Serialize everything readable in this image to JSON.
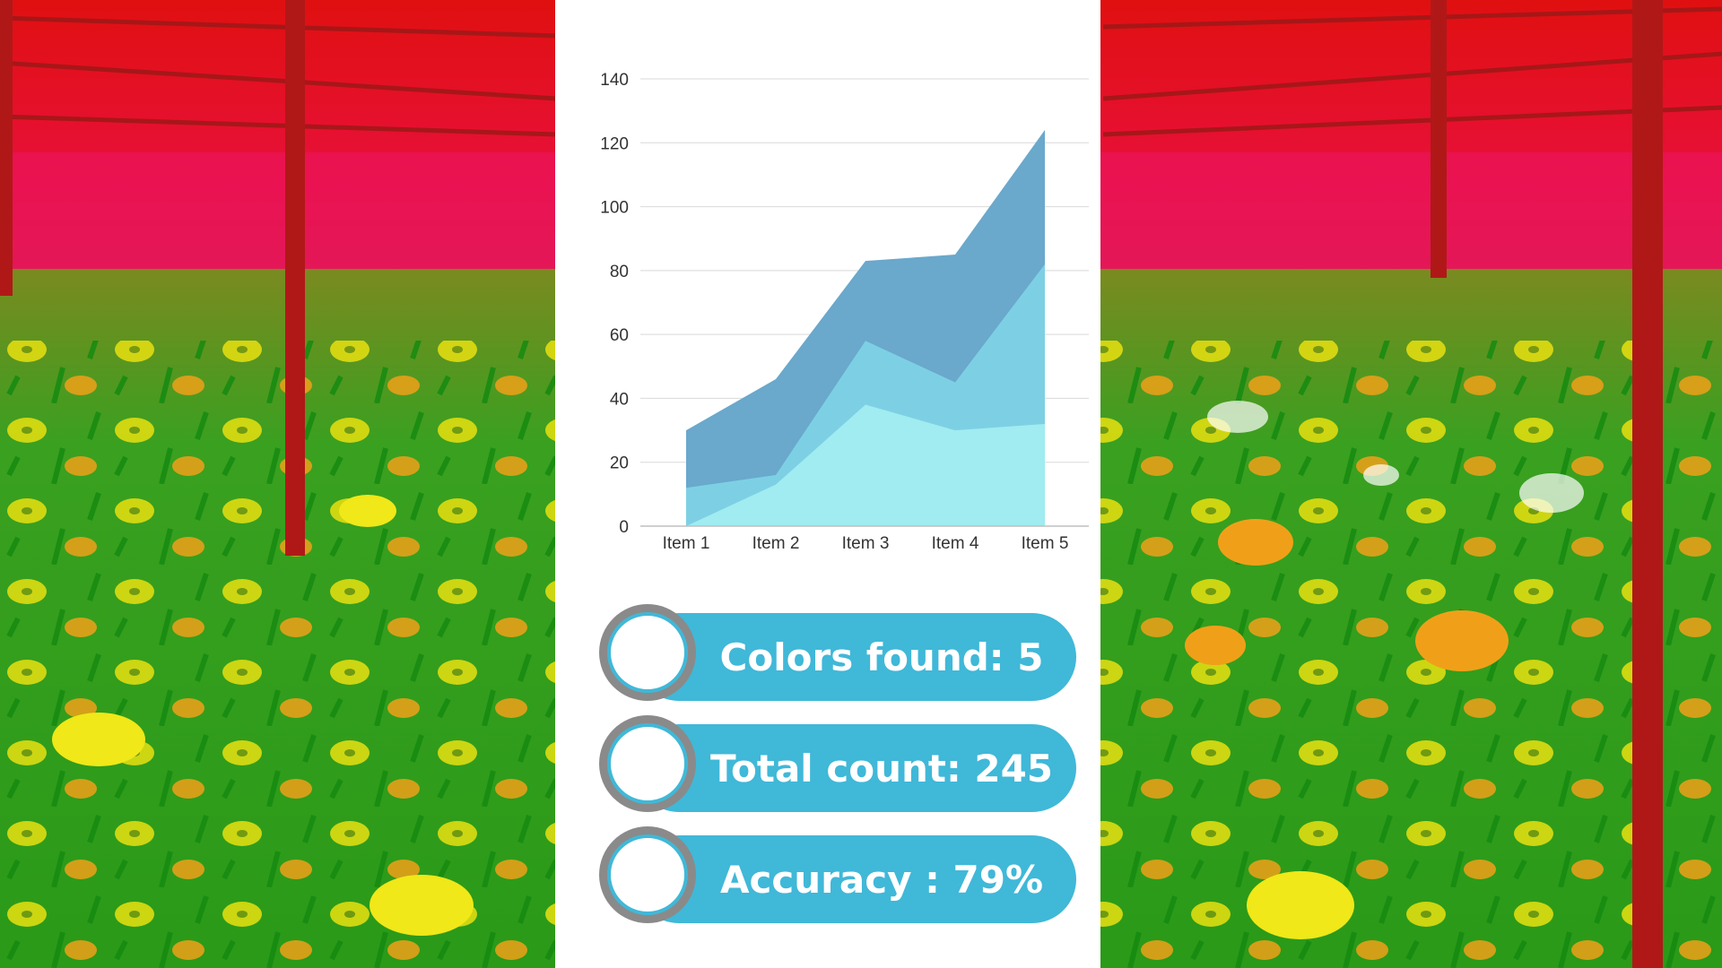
{
  "colors": {
    "accent": "#40b8d8",
    "ring": "#8a8a8a",
    "series": [
      "#6aa8cc",
      "#7dd0e4",
      "#a0ecf0"
    ]
  },
  "stats": [
    {
      "label": "Colors found: 5"
    },
    {
      "label": "Total count: 245"
    },
    {
      "label": "Accuracy : 79%"
    }
  ],
  "chart_data": {
    "type": "area",
    "stacked": false,
    "categories": [
      "Item 1",
      "Item 2",
      "Item 3",
      "Item 4",
      "Item 5"
    ],
    "series": [
      {
        "values": [
          30,
          46,
          83,
          85,
          124
        ]
      },
      {
        "values": [
          12,
          16,
          58,
          45,
          82
        ]
      },
      {
        "values": [
          0,
          13,
          38,
          30,
          32
        ]
      }
    ],
    "ylim": [
      0,
      140
    ],
    "yticks": [
      0,
      20,
      40,
      60,
      80,
      100,
      120,
      140
    ],
    "grid": true,
    "legend": "none"
  }
}
